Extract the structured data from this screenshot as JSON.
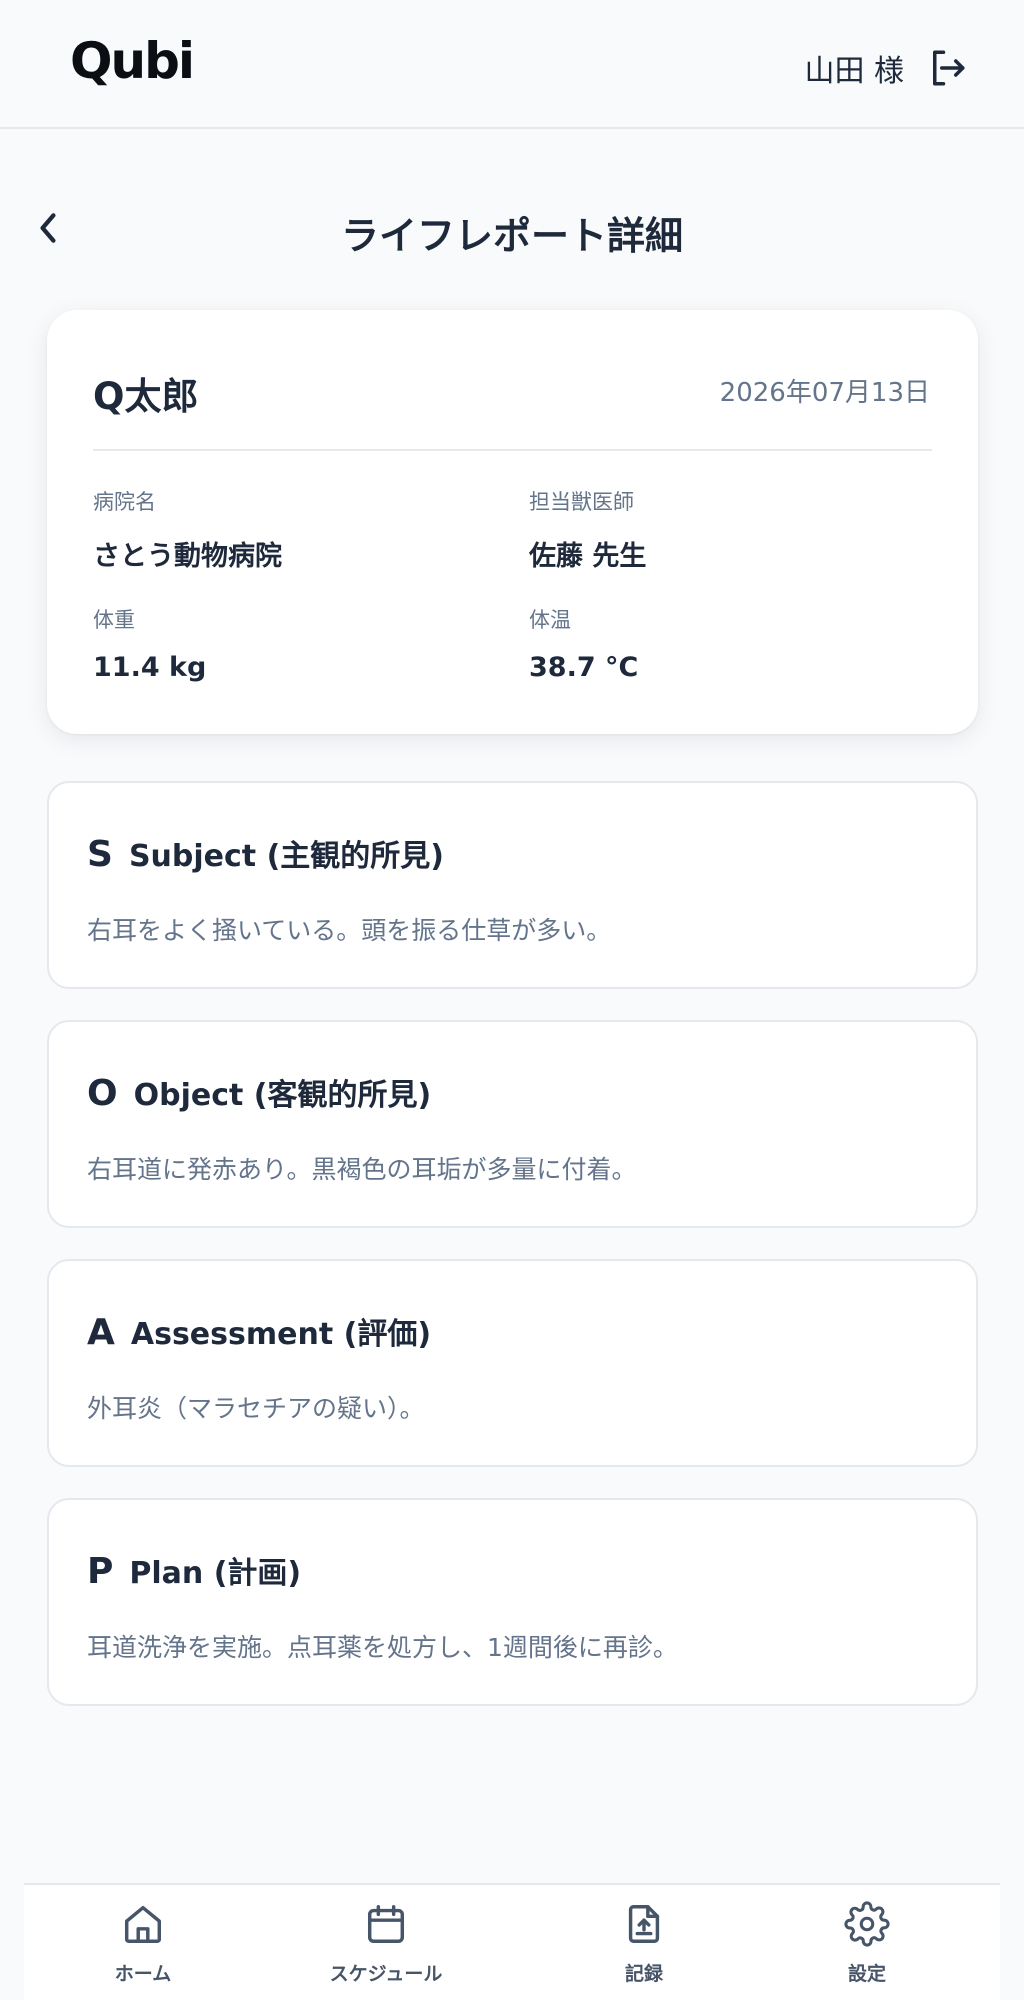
{
  "header": {
    "logo_text": "Qubi",
    "user_name": "山田 様",
    "logout_icon": "logout-icon"
  },
  "page": {
    "title": "ライフレポート詳細",
    "back_icon": "chevron-left-icon"
  },
  "summary": {
    "pet_name": "Q太郎",
    "date": "2026年07月13日",
    "hospital": {
      "label": "病院名",
      "value": "さとう動物病院"
    },
    "vet": {
      "label": "担当獣医師",
      "value": "佐藤 先生"
    },
    "weight": {
      "label": "体重",
      "value": "11.4 kg"
    },
    "temperature": {
      "label": "体温",
      "value": "38.7 °C"
    }
  },
  "soap": [
    {
      "letter": "S",
      "title": "Subject (主観的所見)",
      "body": "右耳をよく掻いている。頭を振る仕草が多い。"
    },
    {
      "letter": "O",
      "title": "Object (客観的所見)",
      "body": "右耳道に発赤あり。黒褐色の耳垢が多量に付着。"
    },
    {
      "letter": "A",
      "title": "Assessment (評価)",
      "body": "外耳炎（マラセチアの疑い）。"
    },
    {
      "letter": "P",
      "title": "Plan (計画)",
      "body": "耳道洗浄を実施。点耳薬を処方し、1週間後に再診。"
    }
  ],
  "nav": [
    {
      "label": "ホーム",
      "icon": "home-icon"
    },
    {
      "label": "スケジュール",
      "icon": "calendar-icon"
    },
    {
      "label": "記録",
      "icon": "document-icon"
    },
    {
      "label": "設定",
      "icon": "gear-icon"
    }
  ],
  "colors": {
    "background": "#f8fafc",
    "text_primary": "#1e293b",
    "text_secondary": "#64748b",
    "border": "#e5e8ec",
    "card": "#ffffff"
  }
}
